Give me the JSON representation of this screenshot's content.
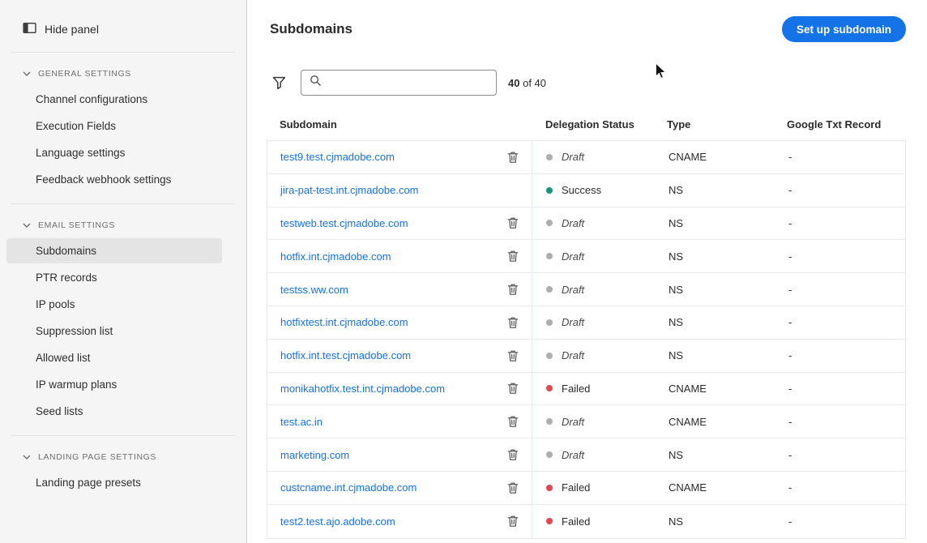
{
  "sidebar": {
    "hide_panel": "Hide panel",
    "selected_item": "Subdomains",
    "sections": [
      {
        "label": "GENERAL SETTINGS",
        "items": [
          "Channel configurations",
          "Execution Fields",
          "Language settings",
          "Feedback webhook settings"
        ]
      },
      {
        "label": "EMAIL SETTINGS",
        "items": [
          "Subdomains",
          "PTR records",
          "IP pools",
          "Suppression list",
          "Allowed list",
          "IP warmup plans",
          "Seed lists"
        ]
      },
      {
        "label": "LANDING PAGE SETTINGS",
        "items": [
          "Landing page presets"
        ]
      }
    ]
  },
  "header": {
    "title": "Subdomains",
    "setup_button": "Set up subdomain"
  },
  "toolbar": {
    "search_value": "",
    "search_placeholder": "",
    "count": "40",
    "count_suffix": "of 40"
  },
  "table": {
    "columns": [
      "Subdomain",
      "Delegation Status",
      "Type",
      "Google Txt Record"
    ],
    "rows": [
      {
        "subdomain": "test9.test.cjmadobe.com",
        "deletable": "true",
        "status": "Draft",
        "type": "CNAME",
        "google_txt": "-"
      },
      {
        "subdomain": "jira-pat-test.int.cjmadobe.com",
        "deletable": "false",
        "status": "Success",
        "type": "NS",
        "google_txt": "-"
      },
      {
        "subdomain": "testweb.test.cjmadobe.com",
        "deletable": "true",
        "status": "Draft",
        "type": "NS",
        "google_txt": "-"
      },
      {
        "subdomain": "hotfix.int.cjmadobe.com",
        "deletable": "true",
        "status": "Draft",
        "type": "NS",
        "google_txt": "-"
      },
      {
        "subdomain": "testss.ww.com",
        "deletable": "true",
        "status": "Draft",
        "type": "NS",
        "google_txt": "-"
      },
      {
        "subdomain": "hotfixtest.int.cjmadobe.com",
        "deletable": "true",
        "status": "Draft",
        "type": "NS",
        "google_txt": "-"
      },
      {
        "subdomain": "hotfix.int.test.cjmadobe.com",
        "deletable": "true",
        "status": "Draft",
        "type": "NS",
        "google_txt": "-"
      },
      {
        "subdomain": "monikahotfix.test.int.cjmadobe.com",
        "deletable": "true",
        "status": "Failed",
        "type": "CNAME",
        "google_txt": "-"
      },
      {
        "subdomain": "test.ac.in",
        "deletable": "true",
        "status": "Draft",
        "type": "CNAME",
        "google_txt": "-"
      },
      {
        "subdomain": "marketing.com",
        "deletable": "true",
        "status": "Draft",
        "type": "NS",
        "google_txt": "-"
      },
      {
        "subdomain": "custcname.int.cjmadobe.com",
        "deletable": "true",
        "status": "Failed",
        "type": "CNAME",
        "google_txt": "-"
      },
      {
        "subdomain": "test2.test.ajo.adobe.com",
        "deletable": "true",
        "status": "Failed",
        "type": "NS",
        "google_txt": "-"
      }
    ]
  },
  "colors": {
    "accent": "#1473e6",
    "success_dot": "#12957a",
    "failed_dot": "#e34850",
    "draft_dot": "#aeaeae",
    "sidebar_bg": "#f5f5f5",
    "selected_bg": "#e4e4e4"
  }
}
